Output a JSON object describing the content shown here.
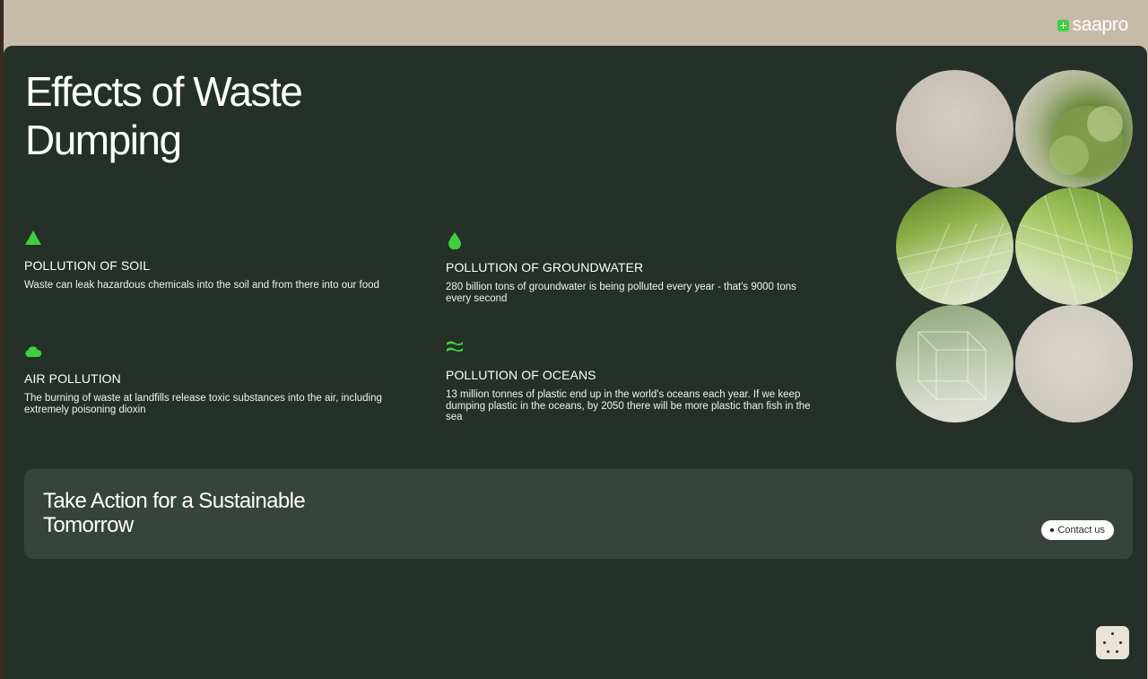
{
  "brand": {
    "name": "saapro",
    "icon": "plus-badge-icon"
  },
  "page": {
    "title": "Effects of Waste Dumping"
  },
  "effects": [
    {
      "icon": "triangle-icon",
      "label": "POLLUTION OF SOIL",
      "description": "Waste can leak hazardous chemicals into the soil and from there into our food"
    },
    {
      "icon": "droplet-icon",
      "label": "POLLUTION OF GROUNDWATER",
      "description": "280 billion tons of groundwater is being polluted every year - that's 9000 tons every second"
    },
    {
      "icon": "cloud-icon",
      "label": "AIR POLLUTION",
      "description": "The burning of waste at landfills release toxic substances into the air, including extremely poisoning dioxin"
    },
    {
      "icon": "waves-icon",
      "label": "POLLUTION OF OCEANS",
      "description": "13 million tonnes of plastic end up in the world's oceans each year. If we keep dumping plastic in the oceans, by 2050 there will be more plastic than fish in the sea"
    }
  ],
  "cta": {
    "title": "Take Action for a Sustainable Tomorrow",
    "button_label": "Contact us"
  },
  "colors": {
    "background": "#253028",
    "card": "#37443b",
    "accent": "#3fcf3f",
    "top_bar": "#c8baa8"
  }
}
